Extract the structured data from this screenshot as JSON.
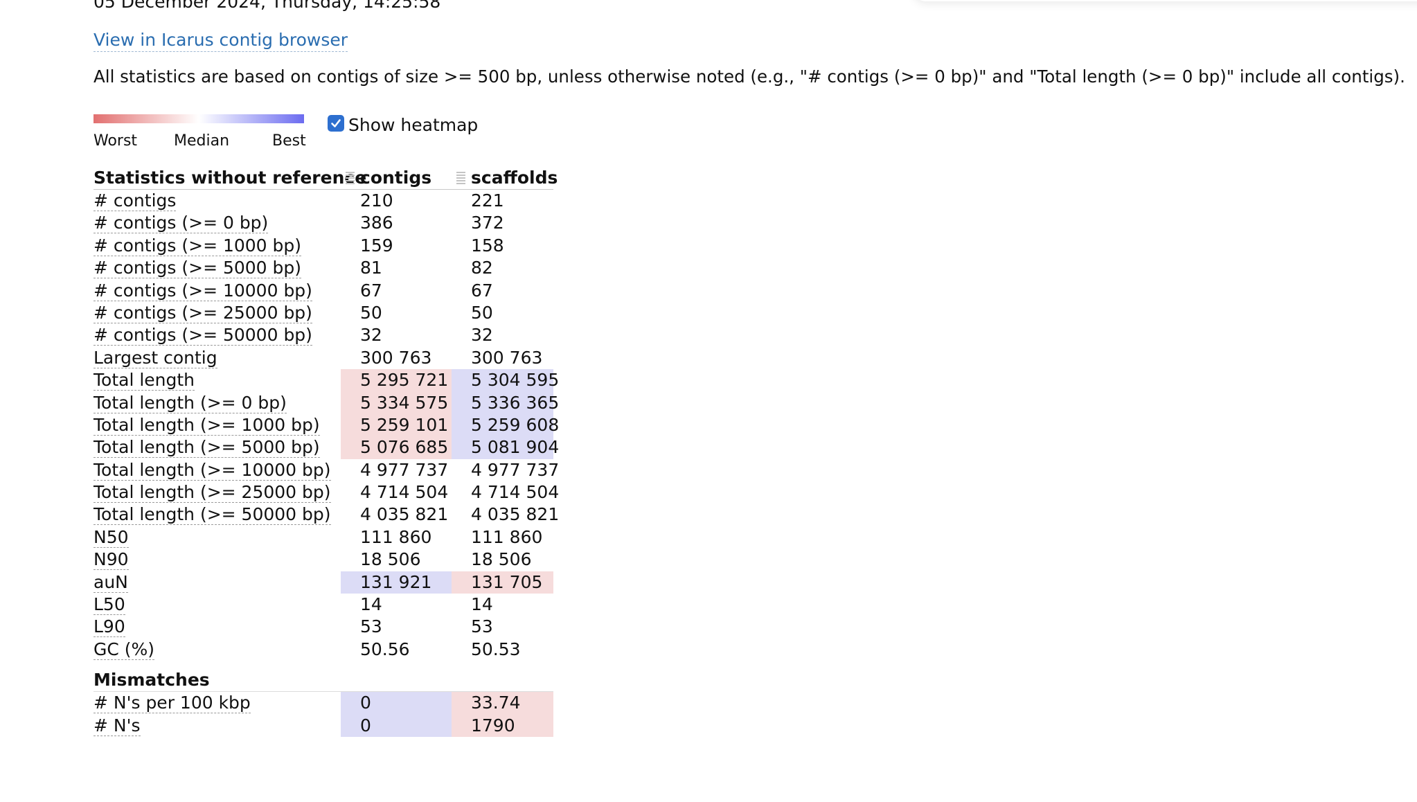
{
  "report": {
    "datetime": "05 December 2024, Thursday, 14:25:58",
    "icarus_link": "View in Icarus contig browser",
    "note": "All statistics are based on contigs of size >= 500 bp, unless otherwise noted (e.g., \"# contigs (>= 0 bp)\" and \"Total length (>= 0 bp)\" include all contigs)."
  },
  "legend": {
    "worst": "Worst",
    "median": "Median",
    "best": "Best",
    "worst_color": "#e27070",
    "median_color": "#ffffff",
    "best_color": "#6c6cf0"
  },
  "heatmap_toggle": {
    "label": "Show heatmap",
    "checked": true,
    "icon": "checkmark-icon"
  },
  "colors": {
    "worse_cell": "#f6dcdc",
    "better_cell": "#dcdcf6",
    "link": "#2a6db0",
    "checkbox": "#2d6fcf"
  },
  "table": {
    "headers": {
      "metric": "Statistics without reference",
      "col1": "contigs",
      "col2": "scaffolds"
    },
    "rows": [
      {
        "label": "# contigs",
        "contigs": "210",
        "scaffolds": "221",
        "h1": "",
        "h2": ""
      },
      {
        "label": "# contigs (>= 0 bp)",
        "contigs": "386",
        "scaffolds": "372",
        "h1": "",
        "h2": ""
      },
      {
        "label": "# contigs (>= 1000 bp)",
        "contigs": "159",
        "scaffolds": "158",
        "h1": "",
        "h2": ""
      },
      {
        "label": "# contigs (>= 5000 bp)",
        "contigs": "81",
        "scaffolds": "82",
        "h1": "",
        "h2": ""
      },
      {
        "label": "# contigs (>= 10000 bp)",
        "contigs": "67",
        "scaffolds": "67",
        "h1": "",
        "h2": ""
      },
      {
        "label": "# contigs (>= 25000 bp)",
        "contigs": "50",
        "scaffolds": "50",
        "h1": "",
        "h2": ""
      },
      {
        "label": "# contigs (>= 50000 bp)",
        "contigs": "32",
        "scaffolds": "32",
        "h1": "",
        "h2": ""
      },
      {
        "label": "Largest contig",
        "contigs": "300 763",
        "scaffolds": "300 763",
        "h1": "",
        "h2": ""
      },
      {
        "label": "Total length",
        "contigs": "5 295 721",
        "scaffolds": "5 304 595",
        "h1": "worst",
        "h2": "best"
      },
      {
        "label": "Total length (>= 0 bp)",
        "contigs": "5 334 575",
        "scaffolds": "5 336 365",
        "h1": "worst",
        "h2": "best"
      },
      {
        "label": "Total length (>= 1000 bp)",
        "contigs": "5 259 101",
        "scaffolds": "5 259 608",
        "h1": "worst",
        "h2": "best"
      },
      {
        "label": "Total length (>= 5000 bp)",
        "contigs": "5 076 685",
        "scaffolds": "5 081 904",
        "h1": "worst",
        "h2": "best"
      },
      {
        "label": "Total length (>= 10000 bp)",
        "contigs": "4 977 737",
        "scaffolds": "4 977 737",
        "h1": "",
        "h2": ""
      },
      {
        "label": "Total length (>= 25000 bp)",
        "contigs": "4 714 504",
        "scaffolds": "4 714 504",
        "h1": "",
        "h2": ""
      },
      {
        "label": "Total length (>= 50000 bp)",
        "contigs": "4 035 821",
        "scaffolds": "4 035 821",
        "h1": "",
        "h2": ""
      },
      {
        "label": "N50",
        "contigs": "111 860",
        "scaffolds": "111 860",
        "h1": "",
        "h2": ""
      },
      {
        "label": "N90",
        "contigs": "18 506",
        "scaffolds": "18 506",
        "h1": "",
        "h2": ""
      },
      {
        "label": "auN",
        "contigs": "131 921",
        "scaffolds": "131 705",
        "h1": "best",
        "h2": "worst"
      },
      {
        "label": "L50",
        "contigs": "14",
        "scaffolds": "14",
        "h1": "",
        "h2": ""
      },
      {
        "label": "L90",
        "contigs": "53",
        "scaffolds": "53",
        "h1": "",
        "h2": ""
      },
      {
        "label": "GC (%)",
        "contigs": "50.56",
        "scaffolds": "50.53",
        "h1": "",
        "h2": ""
      }
    ]
  },
  "mismatches": {
    "title": "Mismatches",
    "rows": [
      {
        "label": "# N's per 100 kbp",
        "contigs": "0",
        "scaffolds": "33.74",
        "h1": "best",
        "h2": "worst"
      },
      {
        "label": "# N's",
        "contigs": "0",
        "scaffolds": "1790",
        "h1": "best",
        "h2": "worst"
      }
    ]
  }
}
